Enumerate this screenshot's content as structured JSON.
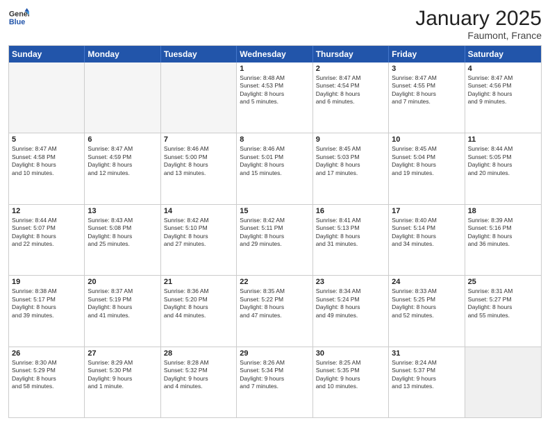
{
  "logo": {
    "general": "General",
    "blue": "Blue"
  },
  "header": {
    "month": "January 2025",
    "location": "Faumont, France"
  },
  "weekdays": [
    "Sunday",
    "Monday",
    "Tuesday",
    "Wednesday",
    "Thursday",
    "Friday",
    "Saturday"
  ],
  "rows": [
    [
      {
        "day": "",
        "lines": [],
        "empty": true
      },
      {
        "day": "",
        "lines": [],
        "empty": true
      },
      {
        "day": "",
        "lines": [],
        "empty": true
      },
      {
        "day": "1",
        "lines": [
          "Sunrise: 8:48 AM",
          "Sunset: 4:53 PM",
          "Daylight: 8 hours",
          "and 5 minutes."
        ]
      },
      {
        "day": "2",
        "lines": [
          "Sunrise: 8:47 AM",
          "Sunset: 4:54 PM",
          "Daylight: 8 hours",
          "and 6 minutes."
        ]
      },
      {
        "day": "3",
        "lines": [
          "Sunrise: 8:47 AM",
          "Sunset: 4:55 PM",
          "Daylight: 8 hours",
          "and 7 minutes."
        ]
      },
      {
        "day": "4",
        "lines": [
          "Sunrise: 8:47 AM",
          "Sunset: 4:56 PM",
          "Daylight: 8 hours",
          "and 9 minutes."
        ]
      }
    ],
    [
      {
        "day": "5",
        "lines": [
          "Sunrise: 8:47 AM",
          "Sunset: 4:58 PM",
          "Daylight: 8 hours",
          "and 10 minutes."
        ]
      },
      {
        "day": "6",
        "lines": [
          "Sunrise: 8:47 AM",
          "Sunset: 4:59 PM",
          "Daylight: 8 hours",
          "and 12 minutes."
        ]
      },
      {
        "day": "7",
        "lines": [
          "Sunrise: 8:46 AM",
          "Sunset: 5:00 PM",
          "Daylight: 8 hours",
          "and 13 minutes."
        ]
      },
      {
        "day": "8",
        "lines": [
          "Sunrise: 8:46 AM",
          "Sunset: 5:01 PM",
          "Daylight: 8 hours",
          "and 15 minutes."
        ]
      },
      {
        "day": "9",
        "lines": [
          "Sunrise: 8:45 AM",
          "Sunset: 5:03 PM",
          "Daylight: 8 hours",
          "and 17 minutes."
        ]
      },
      {
        "day": "10",
        "lines": [
          "Sunrise: 8:45 AM",
          "Sunset: 5:04 PM",
          "Daylight: 8 hours",
          "and 19 minutes."
        ]
      },
      {
        "day": "11",
        "lines": [
          "Sunrise: 8:44 AM",
          "Sunset: 5:05 PM",
          "Daylight: 8 hours",
          "and 20 minutes."
        ]
      }
    ],
    [
      {
        "day": "12",
        "lines": [
          "Sunrise: 8:44 AM",
          "Sunset: 5:07 PM",
          "Daylight: 8 hours",
          "and 22 minutes."
        ]
      },
      {
        "day": "13",
        "lines": [
          "Sunrise: 8:43 AM",
          "Sunset: 5:08 PM",
          "Daylight: 8 hours",
          "and 25 minutes."
        ]
      },
      {
        "day": "14",
        "lines": [
          "Sunrise: 8:42 AM",
          "Sunset: 5:10 PM",
          "Daylight: 8 hours",
          "and 27 minutes."
        ]
      },
      {
        "day": "15",
        "lines": [
          "Sunrise: 8:42 AM",
          "Sunset: 5:11 PM",
          "Daylight: 8 hours",
          "and 29 minutes."
        ]
      },
      {
        "day": "16",
        "lines": [
          "Sunrise: 8:41 AM",
          "Sunset: 5:13 PM",
          "Daylight: 8 hours",
          "and 31 minutes."
        ]
      },
      {
        "day": "17",
        "lines": [
          "Sunrise: 8:40 AM",
          "Sunset: 5:14 PM",
          "Daylight: 8 hours",
          "and 34 minutes."
        ]
      },
      {
        "day": "18",
        "lines": [
          "Sunrise: 8:39 AM",
          "Sunset: 5:16 PM",
          "Daylight: 8 hours",
          "and 36 minutes."
        ]
      }
    ],
    [
      {
        "day": "19",
        "lines": [
          "Sunrise: 8:38 AM",
          "Sunset: 5:17 PM",
          "Daylight: 8 hours",
          "and 39 minutes."
        ]
      },
      {
        "day": "20",
        "lines": [
          "Sunrise: 8:37 AM",
          "Sunset: 5:19 PM",
          "Daylight: 8 hours",
          "and 41 minutes."
        ]
      },
      {
        "day": "21",
        "lines": [
          "Sunrise: 8:36 AM",
          "Sunset: 5:20 PM",
          "Daylight: 8 hours",
          "and 44 minutes."
        ]
      },
      {
        "day": "22",
        "lines": [
          "Sunrise: 8:35 AM",
          "Sunset: 5:22 PM",
          "Daylight: 8 hours",
          "and 47 minutes."
        ]
      },
      {
        "day": "23",
        "lines": [
          "Sunrise: 8:34 AM",
          "Sunset: 5:24 PM",
          "Daylight: 8 hours",
          "and 49 minutes."
        ]
      },
      {
        "day": "24",
        "lines": [
          "Sunrise: 8:33 AM",
          "Sunset: 5:25 PM",
          "Daylight: 8 hours",
          "and 52 minutes."
        ]
      },
      {
        "day": "25",
        "lines": [
          "Sunrise: 8:31 AM",
          "Sunset: 5:27 PM",
          "Daylight: 8 hours",
          "and 55 minutes."
        ]
      }
    ],
    [
      {
        "day": "26",
        "lines": [
          "Sunrise: 8:30 AM",
          "Sunset: 5:29 PM",
          "Daylight: 8 hours",
          "and 58 minutes."
        ]
      },
      {
        "day": "27",
        "lines": [
          "Sunrise: 8:29 AM",
          "Sunset: 5:30 PM",
          "Daylight: 9 hours",
          "and 1 minute."
        ]
      },
      {
        "day": "28",
        "lines": [
          "Sunrise: 8:28 AM",
          "Sunset: 5:32 PM",
          "Daylight: 9 hours",
          "and 4 minutes."
        ]
      },
      {
        "day": "29",
        "lines": [
          "Sunrise: 8:26 AM",
          "Sunset: 5:34 PM",
          "Daylight: 9 hours",
          "and 7 minutes."
        ]
      },
      {
        "day": "30",
        "lines": [
          "Sunrise: 8:25 AM",
          "Sunset: 5:35 PM",
          "Daylight: 9 hours",
          "and 10 minutes."
        ]
      },
      {
        "day": "31",
        "lines": [
          "Sunrise: 8:24 AM",
          "Sunset: 5:37 PM",
          "Daylight: 9 hours",
          "and 13 minutes."
        ]
      },
      {
        "day": "",
        "lines": [],
        "empty": true,
        "shaded": true
      }
    ]
  ]
}
